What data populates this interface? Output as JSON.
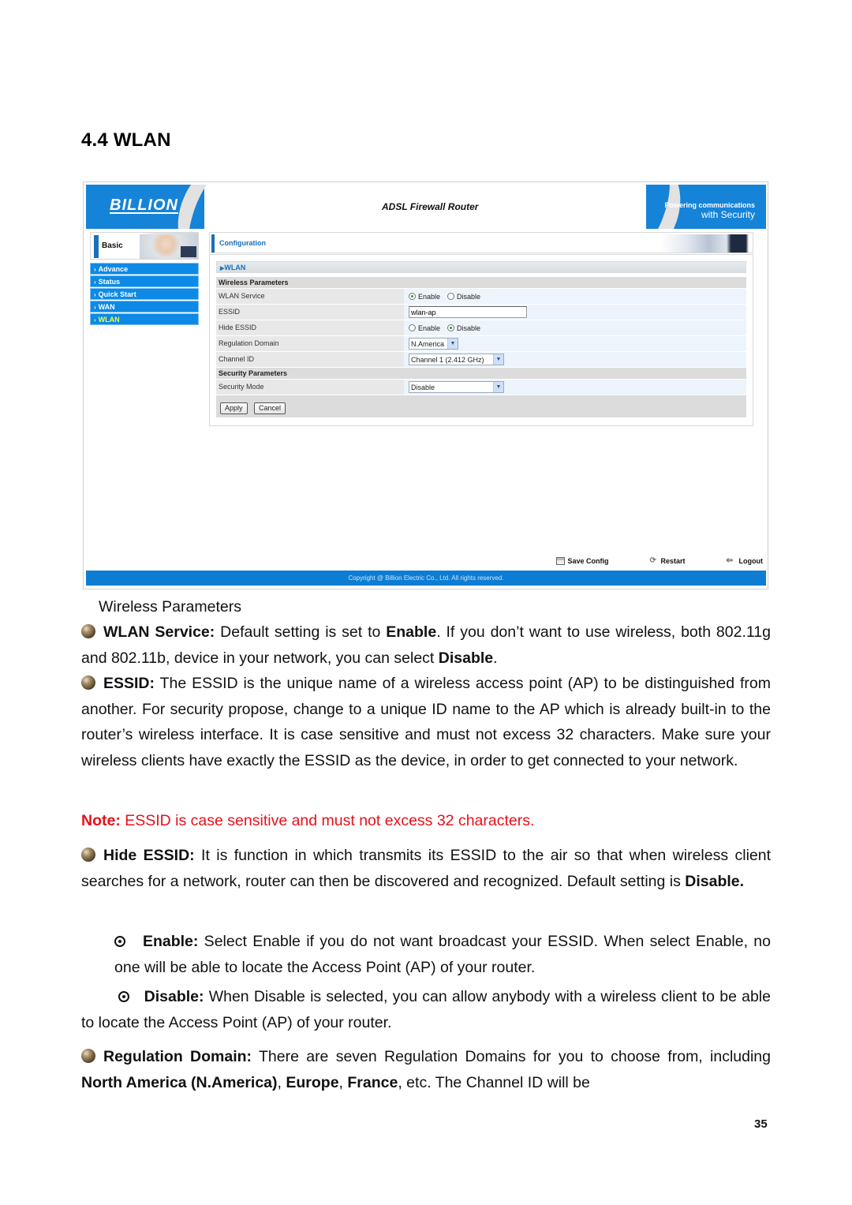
{
  "section": {
    "number": "4.4",
    "title": "4.4 WLAN"
  },
  "router_ui": {
    "brand": "BILLION",
    "title": "ADSL Firewall Router",
    "tagline": {
      "line1": "Powering communications",
      "line2": "with Security"
    },
    "sidebar": {
      "section_label": "Basic",
      "items": [
        {
          "label": "Advance",
          "active": false
        },
        {
          "label": "Status",
          "active": false
        },
        {
          "label": "Quick Start",
          "active": false
        },
        {
          "label": "WAN",
          "active": false
        },
        {
          "label": "WLAN",
          "active": true
        }
      ]
    },
    "panel": {
      "header": "Configuration",
      "page": "WLAN",
      "wireless_section": "Wireless Parameters",
      "fields": {
        "wlan_service": {
          "label": "WLAN Service",
          "options": [
            "Enable",
            "Disable"
          ],
          "selected": "Enable"
        },
        "essid": {
          "label": "ESSID",
          "value": "wlan-ap"
        },
        "hide_essid": {
          "label": "Hide ESSID",
          "options": [
            "Enable",
            "Disable"
          ],
          "selected": "Disable"
        },
        "regulation_domain": {
          "label": "Regulation Domain",
          "value": "N.America"
        },
        "channel_id": {
          "label": "Channel ID",
          "value": "Channel 1 (2.412 GHz)"
        }
      },
      "security_section": "Security Parameters",
      "security_mode": {
        "label": "Security Mode",
        "value": "Disable"
      },
      "buttons": {
        "apply": "Apply",
        "cancel": "Cancel"
      }
    },
    "toolbar": {
      "save_config": "Save Config",
      "restart": "Restart",
      "logout": "Logout"
    },
    "copyright": "Copyright @ Billion Electric Co., Ltd. All rights reserved."
  },
  "doc": {
    "caption": "Wireless Parameters",
    "wlan_service": {
      "term": "WLAN Service:",
      "t1": " Default setting is set to ",
      "b1": "Enable",
      "t2": ". If you don’t want to use wireless, both 802.11g and 802.11b, device in your network, you can select ",
      "b2": "Disable",
      "t3": "."
    },
    "essid": {
      "term": "ESSID:",
      "text": " The ESSID is the unique name of a wireless access point (AP) to be distinguished from another. For security propose, change to a unique ID name to the AP which is already built-in to the router’s wireless interface. It is case sensitive and must not excess 32 characters. Make sure your wireless clients have exactly the ESSID as the device, in order to get connected to your network."
    },
    "note": {
      "label": "Note:",
      "text": " ESSID is case sensitive and must not excess 32 characters."
    },
    "hide_essid": {
      "term": "Hide ESSID:",
      "text": " It is function in which transmits its ESSID to the air so that when wireless client searches for a network, router can then be discovered and recognized. Default setting is ",
      "b1": "Disable."
    },
    "enable_opt": {
      "term": "Enable:",
      "text": " Select Enable if you do not want broadcast your ESSID. When select Enable, no one will be able to locate the Access Point (AP) of your router."
    },
    "disable_opt": {
      "term": "Disable:",
      "text": " When Disable is selected, you can allow anybody with a wireless client to be able to locate the Access Point (AP) of your router."
    },
    "regulation": {
      "term": "Regulation Domain:",
      "t1": " There are seven Regulation Domains for you to choose from, including ",
      "b1": "North America (N.America)",
      "t2": ", ",
      "b2": "Europe",
      "t3": ", ",
      "b3": "France",
      "t4": ", etc. The Channel ID will be"
    },
    "page_number": "35"
  }
}
